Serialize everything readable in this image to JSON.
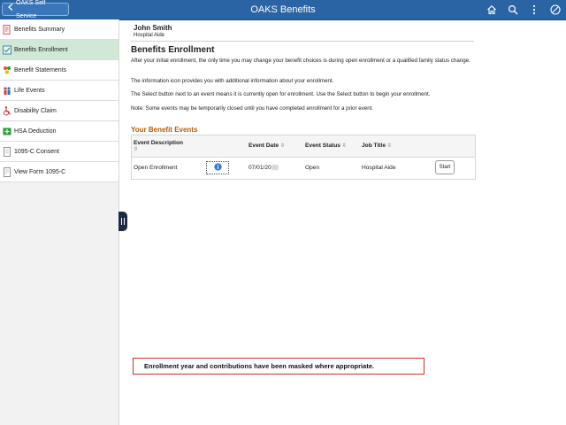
{
  "header": {
    "back_label": "OAKS Self Service",
    "title": "OAKS Benefits",
    "accent": "#2a64a4"
  },
  "sidebar": {
    "items": [
      {
        "label": "Benefits Summary",
        "icon": "benefits-summary-icon",
        "active": false
      },
      {
        "label": "Benefits Enrollment",
        "icon": "benefits-enrollment-icon",
        "active": true
      },
      {
        "label": "Benefit Statements",
        "icon": "benefit-statements-icon",
        "active": false
      },
      {
        "label": "Life Events",
        "icon": "life-events-icon",
        "active": false
      },
      {
        "label": "Disability Claim",
        "icon": "disability-icon",
        "active": false
      },
      {
        "label": "HSA Deduction",
        "icon": "hsa-icon",
        "active": false
      },
      {
        "label": "1095-C Consent",
        "icon": "document-icon",
        "active": false
      },
      {
        "label": "View Form 1095-C",
        "icon": "form-icon",
        "active": false
      }
    ]
  },
  "person": {
    "name": "John Smith",
    "title": "Hospital Aide"
  },
  "main": {
    "page_title": "Benefits Enrollment",
    "paragraphs": [
      "After your initial enrollment, the only time you may change your benefit choices is during open enrollment or a qualified family status change.",
      "The information icon provides you with additional information about your enrollment.",
      "The Select button next to an event means it is currently open for enrollment. Use the Select button to begin your enrollment.",
      "Note: Some events may be temporarily closed until you have completed enrollment for a prior event."
    ],
    "section_title": "Your Benefit Events",
    "table": {
      "headers": {
        "description": "Event Description",
        "date": "Event Date",
        "status": "Event Status",
        "job": "Job Title"
      },
      "rows": [
        {
          "description": "Open Enrollment",
          "date": "07/01/20",
          "status": "Open",
          "job": "Hospital Aide",
          "action": "Start"
        }
      ]
    }
  },
  "notice": "Enrollment year and contributions have been masked where appropriate."
}
